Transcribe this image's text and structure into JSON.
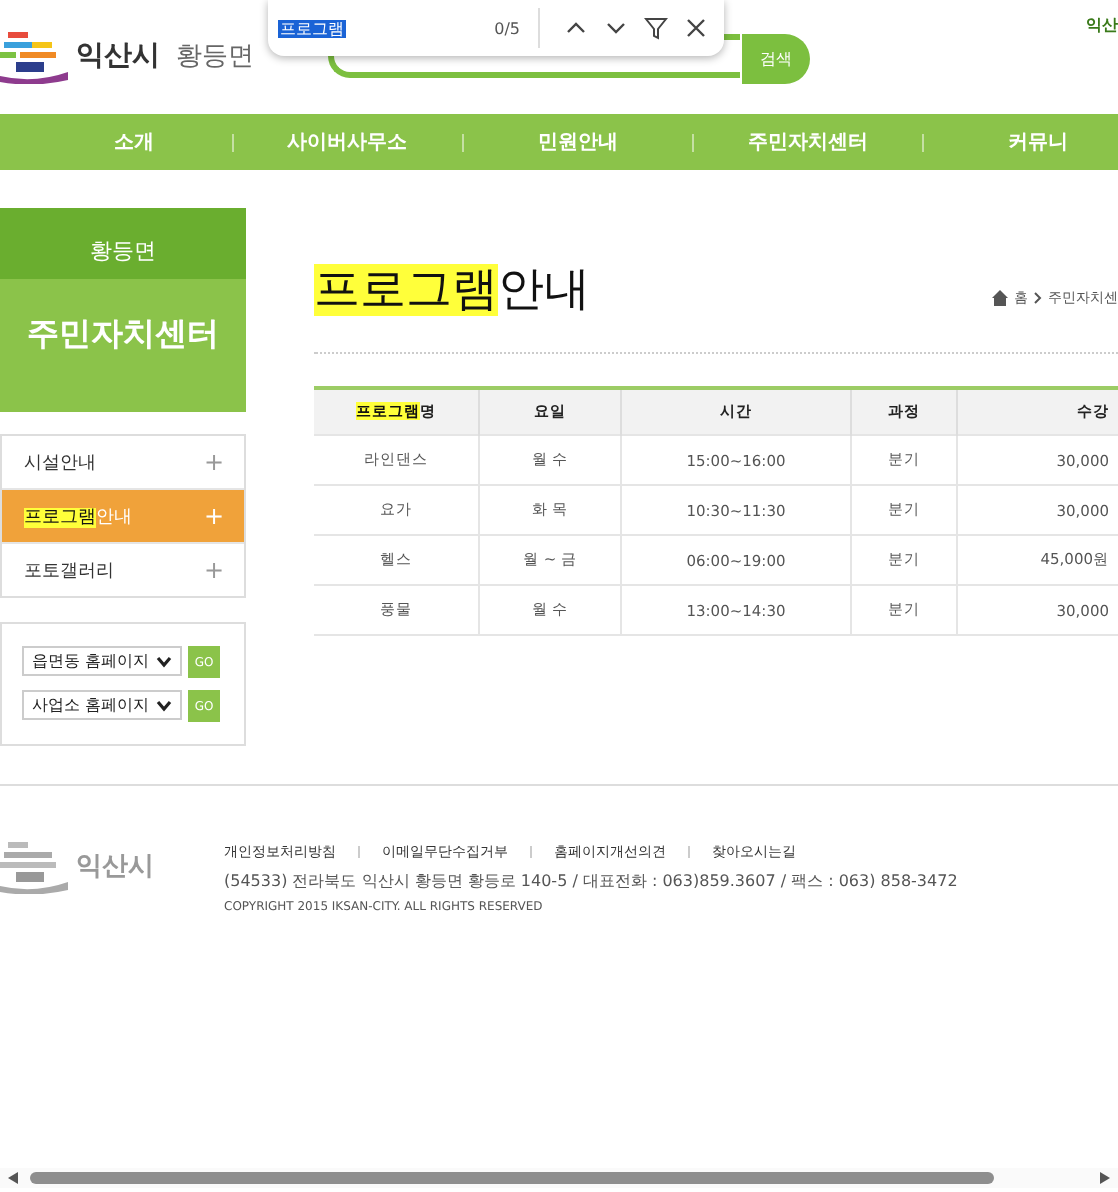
{
  "header": {
    "city": "익산시",
    "town": "황등면",
    "search_button": "검색",
    "top_link": "익산"
  },
  "find_bar": {
    "query": "프로그램",
    "count": "0/5"
  },
  "nav": [
    "소개",
    "사이버사무소",
    "민원안내",
    "주민자치센터",
    "커뮤니"
  ],
  "side_banner": {
    "town": "황등면",
    "title": "주민자치센터"
  },
  "side_menu": [
    {
      "label": "시설안내",
      "selected": false,
      "icon": "+"
    },
    {
      "match": "프로그램",
      "label": "안내",
      "selected": true,
      "icon": "+"
    },
    {
      "label": "포토갤러리",
      "selected": false,
      "icon": "+"
    }
  ],
  "site_selects": [
    {
      "value": "읍면동 홈페이지",
      "button": "GO"
    },
    {
      "value": "사업소 홈페이지",
      "button": "GO"
    }
  ],
  "page_title": {
    "match": "프로그램",
    "rest": "안내"
  },
  "breadcrumb": [
    "홈",
    "주민자치센"
  ],
  "table": {
    "columns": [
      {
        "match": "프로그램",
        "rest": "명"
      },
      {
        "rest": "요일"
      },
      {
        "rest": "시간"
      },
      {
        "rest": "과정"
      },
      {
        "rest": "수강"
      }
    ],
    "rows": [
      [
        "라인댄스",
        "월 수",
        "15:00~16:00",
        "분기",
        "30,000"
      ],
      [
        "요가",
        "화 목",
        "10:30~11:30",
        "분기",
        "30,000"
      ],
      [
        "헬스",
        "월 ~ 금",
        "06:00~19:00",
        "분기",
        "45,000원"
      ],
      [
        "풍물",
        "월 수",
        "13:00~14:30",
        "분기",
        "30,000"
      ]
    ]
  },
  "footer": {
    "logo_text": "익산시",
    "links": [
      "개인정보처리방침",
      "이메일무단수집거부",
      "홈페이지개선의견",
      "찾아오시는길"
    ],
    "address": "(54533) 전라북도 익산시 황등면 황등로 140-5 / 대표전화 : 063)859.3607 / 팩스 : 063) 858-3472",
    "copyright": "COPYRIGHT 2015 IKSAN-CITY. ALL RIGHTS RESERVED"
  }
}
